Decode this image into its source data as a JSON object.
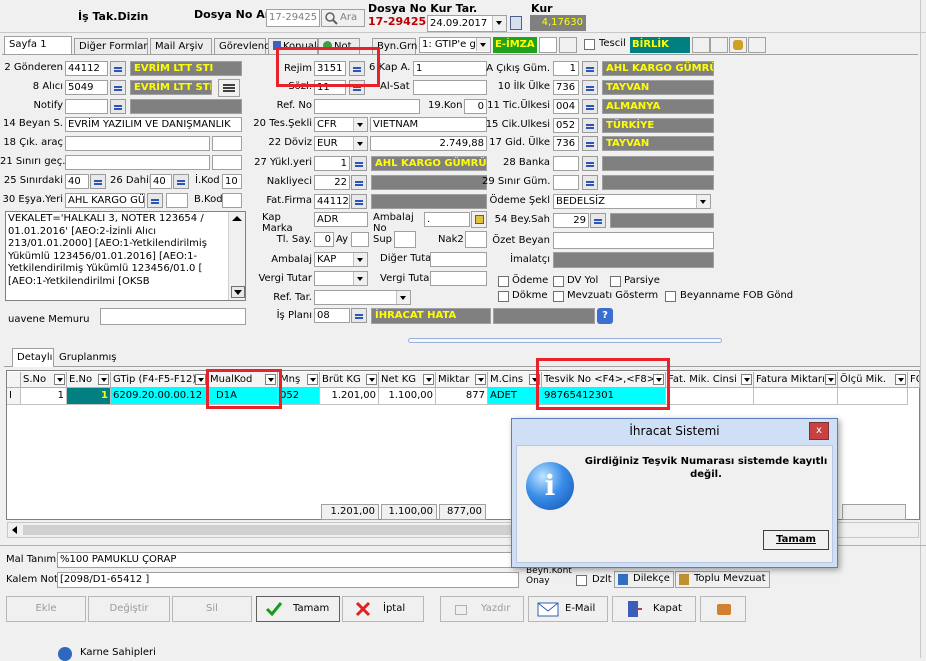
{
  "header": {
    "title": "İş Tak.Dizin",
    "dosya_no_label": "Dosya No Ar",
    "dosya_no_value": "17-29425",
    "search_button": "Ara",
    "dosya_no_kur_label": "Dosya No Kur Tar.",
    "dosya_no_red": "17-29425",
    "date_value": "24.09.2017",
    "kur_label": "Kur",
    "kur_value": "4,17630"
  },
  "tabs": [
    {
      "label": "Sayfa 1"
    },
    {
      "label": "Diğer Formlar"
    },
    {
      "label": "Mail Arşiv"
    },
    {
      "label": "Görevleno"
    },
    {
      "label": "Konuala"
    },
    {
      "label": "Not"
    },
    {
      "label": "Byn.Grn"
    }
  ],
  "toolbar": {
    "gtip_combo": "1: GTIP'e g",
    "eimza": "E-İMZA",
    "tescil_label": "Tescil",
    "birlik": "BİRLİK"
  },
  "left": {
    "gonderen_label": "2 Gönderen",
    "gonderen_code": "44112",
    "gonderen_name": "EVRİM LTT STI",
    "alici_label": "8 Alıcı",
    "alici_code": "5049",
    "alici_name": "EVRİM LTT STI",
    "notify_label": "Notify",
    "beyan_label": "14 Beyan S.",
    "beyan_value": "EVRİM YAZILIM VE DANIŞMANLIK",
    "cik_arac_label": "18 Çık. araç",
    "sinir_gec_label": "21 Sınırı geç.",
    "sinirdaki_label": "25 Sınırdaki",
    "sinirdaki_value": "40",
    "dahili_label": "26 Dahili",
    "dahili_value": "40",
    "ikod_label": "İ.Kod",
    "ikod_value": "10",
    "esya_yeri_label": "30 Eşya.Yeri",
    "esya_yeri_value": "AHL KARGO GÜ",
    "bkod_label": "B.Kod",
    "notes_text": "VEKALET='HALKALI 3, NOTER 123654 / 01.01.2016'            [AEO:2-İzinli Alıcı 213/01.01.2000] [AEO:1-Yetkilendirilmiş Yükümlü 123456/01.01.2016] [AEO:1-Yetkilendirilmiş Yükümlü 123456/01.0 [ [AEO:1-Yetkilendirilmi [OKSB",
    "muavene_label": "uavene Memuru"
  },
  "middle": {
    "rejim_label": "Rejim",
    "rejim_value": "3151",
    "kap_a_label": "6 Kap A.",
    "kap_a_value": "1",
    "sozl_label": "Sözl.",
    "sozl_value": "11",
    "al_sat_label": "Al-Sat",
    "ref_no_label": "Ref. No",
    "kon_label": "19.Kon",
    "kon_value": "0",
    "tes_sekli_label": "20 Tes.Şekli",
    "tes_sekli_value": "CFR",
    "tes_place": "VIETNAM",
    "doviz_label": "22 Döviz",
    "doviz_value": "EUR",
    "doviz_amount": "2.749,88",
    "yukl_yeri_label": "27 Yükl.yeri",
    "yukl_yeri_value": "1",
    "yukl_yeri_name": "AHL KARGO GÜMRÜK",
    "nakliyeci_label": "Nakliyeci",
    "nakliyeci_value": "22",
    "fat_firma_label": "Fat.Firma",
    "fat_firma_value": "44112",
    "kap_marka_label": "Kap Marka",
    "kap_marka_value": "ADR",
    "ambalaj_no_label": "Ambalaj No",
    "ambalaj_no_value": ".",
    "tl_say_label": "Tl. Say.",
    "tl_say_value": "0",
    "ay_label": "Ay",
    "sup_label": "Sup",
    "nak2_label": "Nak2",
    "ambalaj_label": "Ambalaj",
    "ambalaj_value": "KAP",
    "diger_tutar_label": "Diğer Tutar",
    "vergi_tutar_label": "Vergi Tutar",
    "vergi_tutar2_label": "Vergi Tutar",
    "ref_tar_label": "Ref. Tar.",
    "is_plani_label": "İş Planı",
    "is_plani_value": "08",
    "is_plani_status": "İHRACAT HATA"
  },
  "right": {
    "cikis_gum_label": "A Çıkış Güm.",
    "cikis_gum_value": "1",
    "cikis_gum_name": "AHL KARGO GÜMRÜK",
    "ilk_ulke_label": "10 İlk Ülke",
    "ilk_ulke_value": "736",
    "ilk_ulke_name": "TAYVAN",
    "tic_ulkesi_label": "11 Tic.Ülkesi",
    "tic_ulkesi_value": "004",
    "tic_ulkesi_name": "ALMANYA",
    "cik_ulkesi_label": "15 Cik.Ulkesi",
    "cik_ulkesi_value": "052",
    "cik_ulkesi_name": "TÜRKİYE",
    "gid_ulke_label": "17 Gid. Ülke",
    "gid_ulke_value": "736",
    "gid_ulke_name": "TAYVAN",
    "banka_label": "28 Banka",
    "sinir_gum_label": "29 Sınır Güm.",
    "odeme_sekli_label": "Ödeme Şekl",
    "odeme_sekli_value": "BEDELSİZ",
    "bey_sah_label": "54 Bey.Sah",
    "bey_sah_value": "29",
    "ozet_beyan_label": "Özet Beyan",
    "imalatci_label": "İmalatçı",
    "odeme_label": "Ödeme",
    "dv_yol_label": "DV Yol",
    "parsiyel_label": "Parsiye",
    "dokme_label": "Dökme",
    "mevzuati_label": "Mevzuatı Gösterm",
    "fob_label": "Beyanname FOB Gönd"
  },
  "grid": {
    "tabs": [
      {
        "label": "Detaylı"
      },
      {
        "label": "Gruplanmış"
      }
    ],
    "headers": [
      "S.No",
      "E.No",
      "GTip (F4-F5-F12)",
      "MualKod",
      "Mnş",
      "Brüt KG",
      "Net KG",
      "Miktar",
      "M.Cins",
      "Tesvik No <F4>,<F8>",
      "Fat. Mik. Cinsi",
      "Fatura Miktarı",
      "Ölçü Mik.",
      "FO"
    ],
    "row": {
      "marker": "I",
      "sno": "1",
      "eno": "1",
      "gtip": "6209.20.00.00.12",
      "mualkod": "D1A",
      "mns": "052",
      "brut": "1.201,00",
      "net": "1.100,00",
      "miktar": "877",
      "mcins": "ADET",
      "tesvik": "98765412301"
    },
    "totals": {
      "brut": "1.201,00",
      "net": "1.100,00",
      "miktar": "877,00"
    }
  },
  "bottom": {
    "mal_tanimi_label": "Mal Tanımı",
    "mal_tanimi_value": "%100 PAMUKLU ÇORAP",
    "kalem_not_label": "Kalem Not",
    "kalem_not_value": "[2098/D1-65412 ]",
    "beyn_kont_onay_label": "Beyn.Kont Onay",
    "dzlt_label": "Dzlt",
    "dilekce_label": "Dilekçe",
    "toplu_label": "Toplu Mevzuat",
    "karne_label": "Karne Sahipleri"
  },
  "actions": {
    "ekle": "Ekle",
    "degistir": "Değiştir",
    "sil": "Sil",
    "tamam": "Tamam",
    "iptal": "İptal",
    "yazdir": "Yazdır",
    "email": "E-Mail",
    "kapat": "Kapat"
  },
  "dialog": {
    "title": "İhracat Sistemi",
    "message": "Girdiğiniz Teşvik Numarası sistemde kayıtlı değil.",
    "ok": "Tamam"
  },
  "colors": {
    "highlight": "#e8222b",
    "cyan": "#00ffff",
    "disabled_gray": "#808080",
    "yellow_text": "#ffff00",
    "eimza_green": "#1fa31f"
  }
}
